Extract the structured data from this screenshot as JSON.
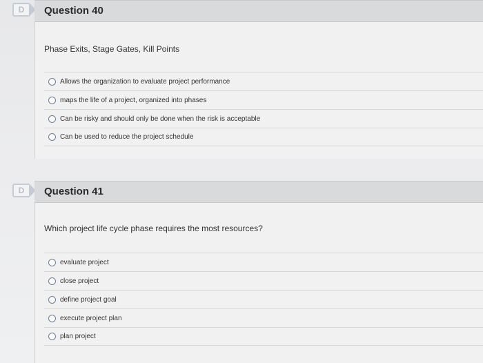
{
  "questions": [
    {
      "flag_icon": "D",
      "title": "Question 40",
      "prompt": "Phase Exits, Stage Gates, Kill Points",
      "options": [
        "Allows the organization to evaluate project performance",
        "maps the life of a project, organized into phases",
        "Can be risky and should only be done when the risk is acceptable",
        "Can be used to reduce the project schedule"
      ]
    },
    {
      "flag_icon": "D",
      "title": "Question 41",
      "prompt": "Which project life cycle phase requires the most resources?",
      "options": [
        "evaluate project",
        "close project",
        "define project goal",
        "execute project plan",
        "plan project"
      ]
    }
  ]
}
